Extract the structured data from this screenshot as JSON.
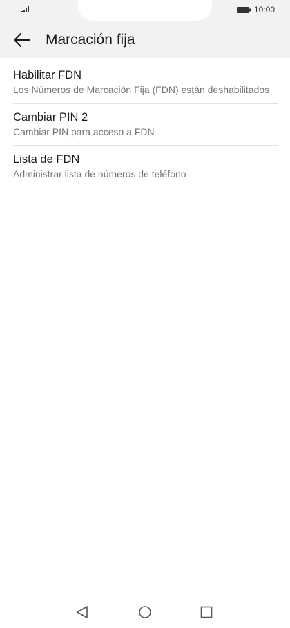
{
  "status": {
    "time": "10:00",
    "signal_icon": "signal-icon",
    "battery_icon": "battery-icon"
  },
  "header": {
    "title": "Marcación fija",
    "back_icon": "arrow-left-icon"
  },
  "items": [
    {
      "title": "Habilitar FDN",
      "subtitle": "Los Números de Marcación Fija (FDN) están deshabilitados"
    },
    {
      "title": "Cambiar PIN 2",
      "subtitle": "Cambiar PIN para acceso a FDN"
    },
    {
      "title": "Lista de FDN",
      "subtitle": "Administrar lista de números de teléfono"
    }
  ],
  "navigation": {
    "back_icon": "triangle-back-icon",
    "home_icon": "circle-home-icon",
    "recents_icon": "square-recents-icon"
  },
  "colors": {
    "bar_bg": "#f2f2f2",
    "text": "#1a1a1a",
    "secondary_text": "#757575",
    "divider": "#e2e2e2"
  }
}
